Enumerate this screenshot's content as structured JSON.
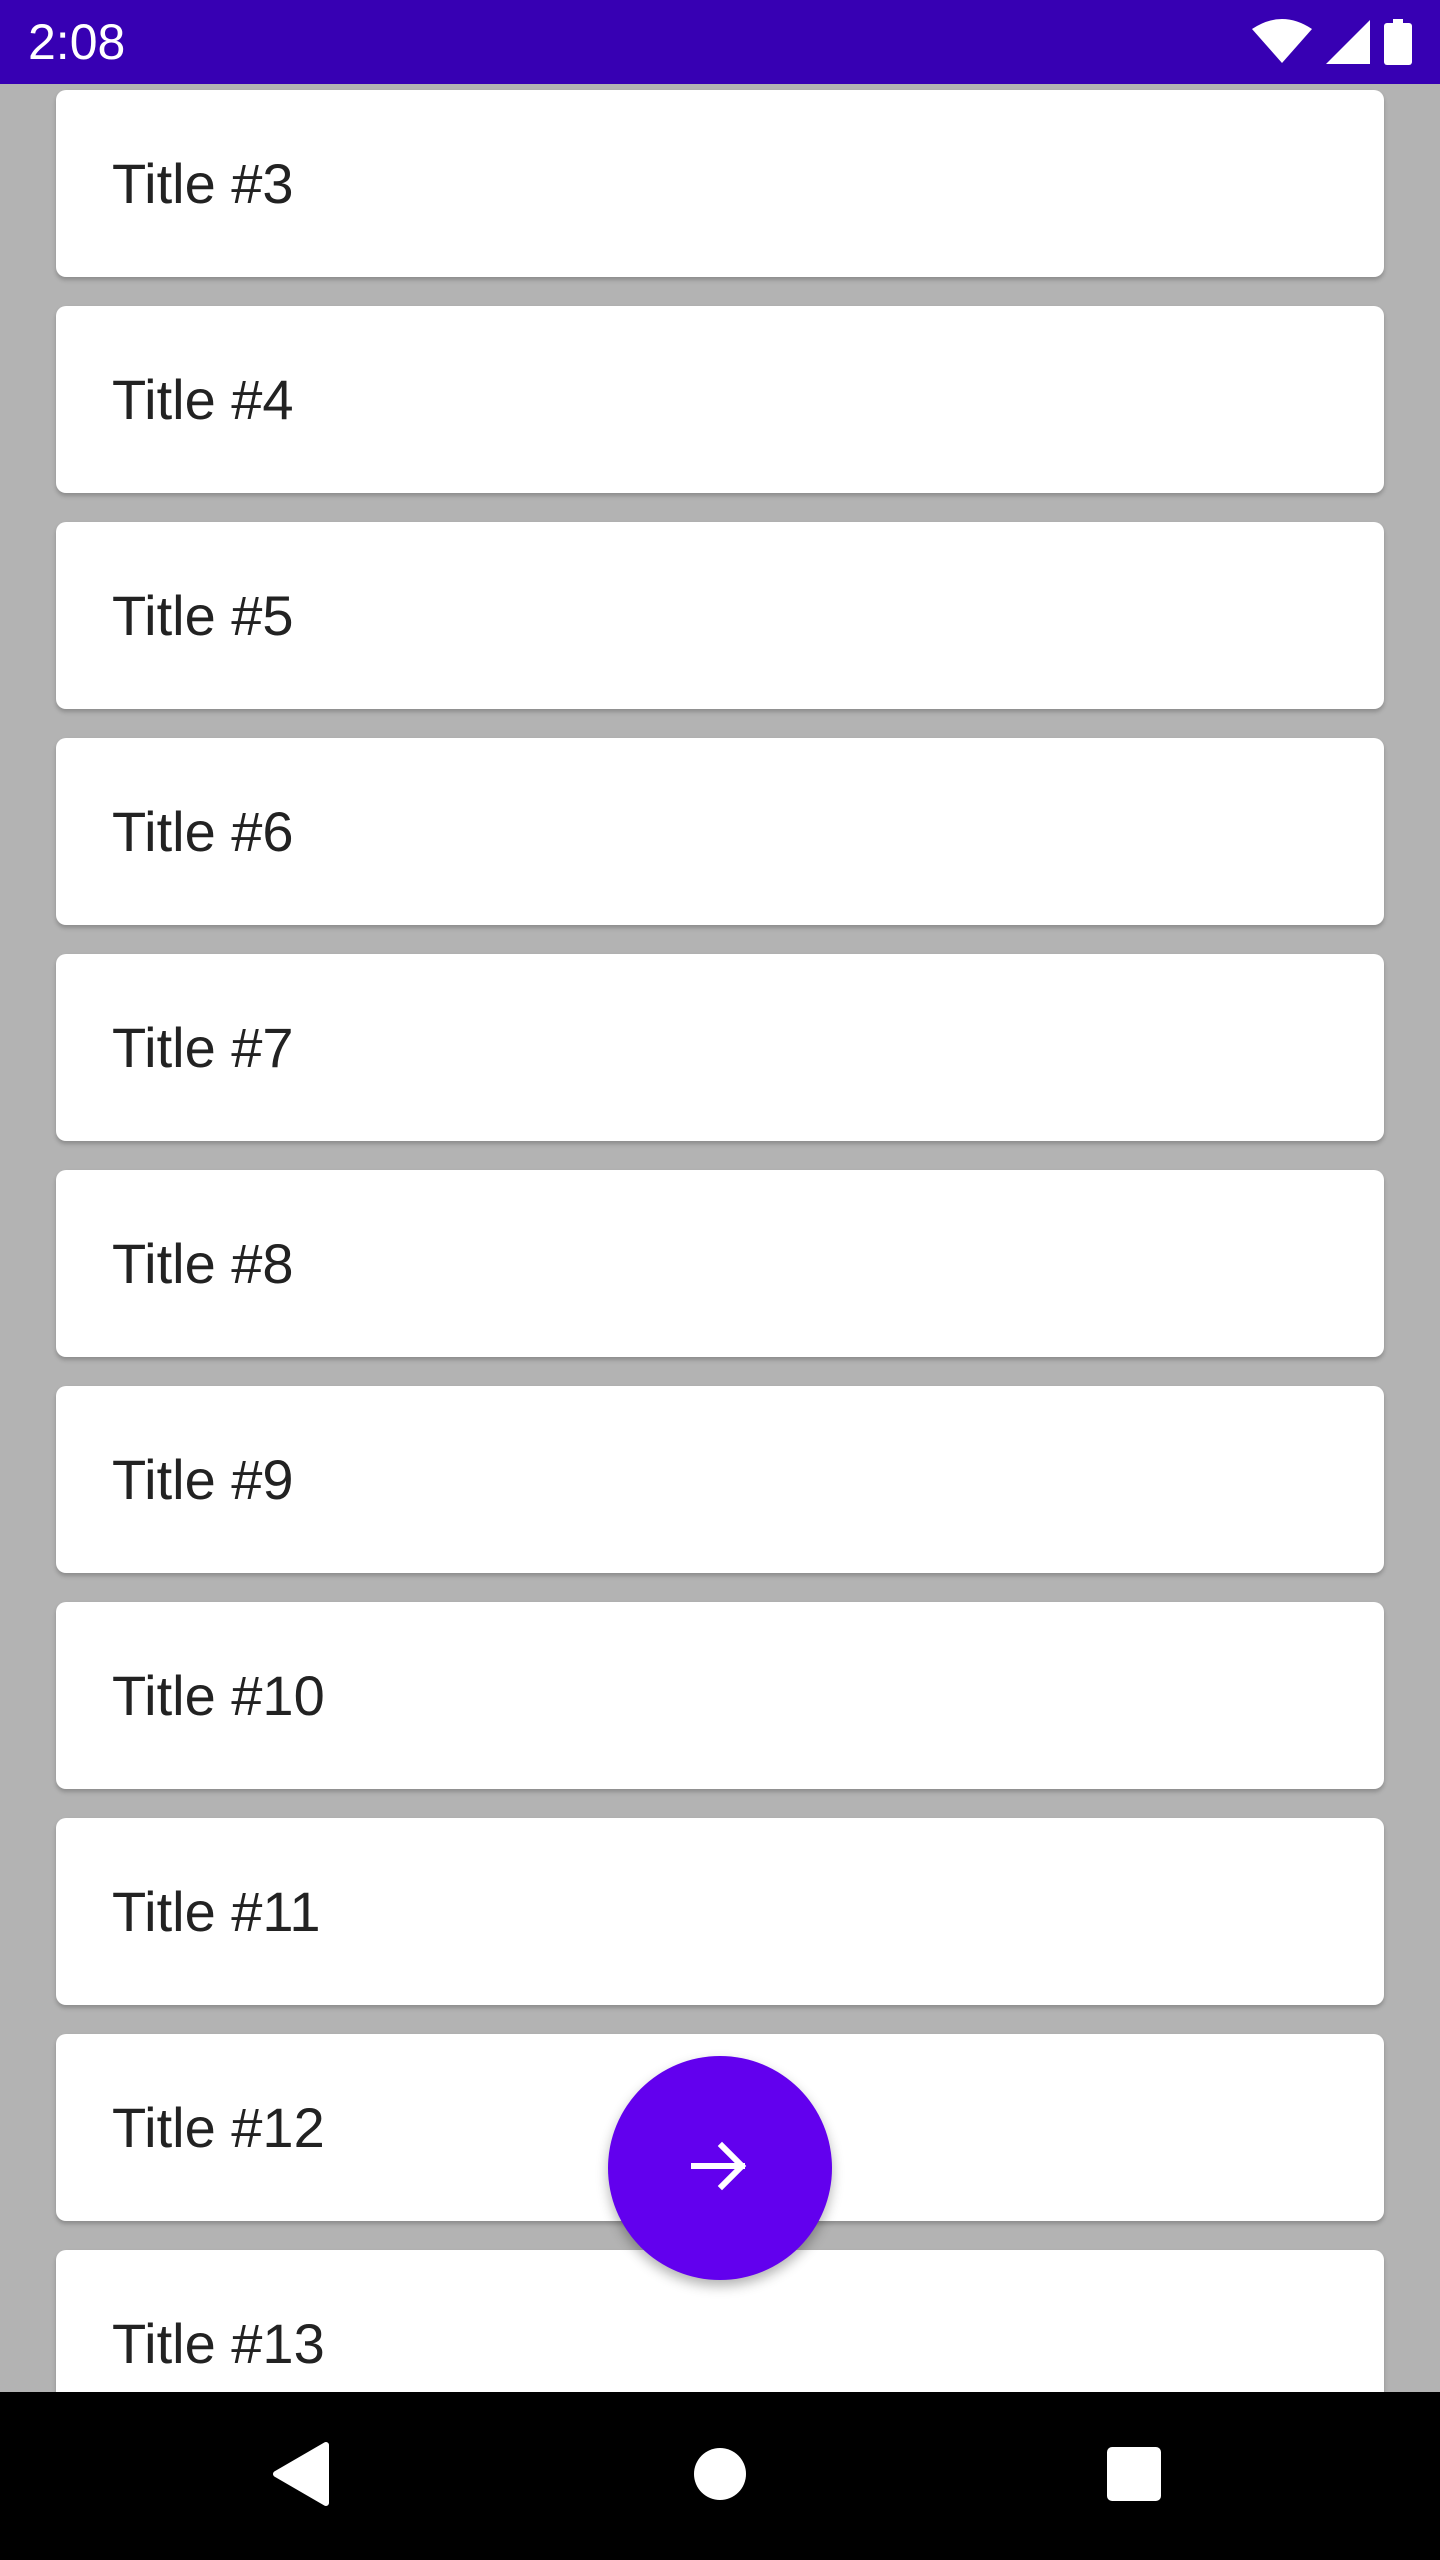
{
  "status_bar": {
    "time": "2:08",
    "background_color": "#3700b3",
    "icons": [
      "wifi-icon",
      "cellular-signal-icon",
      "battery-icon"
    ]
  },
  "list": {
    "background_color": "#b3b3b3",
    "items": [
      {
        "title": "Title #3"
      },
      {
        "title": "Title #4"
      },
      {
        "title": "Title #5"
      },
      {
        "title": "Title #6"
      },
      {
        "title": "Title #7"
      },
      {
        "title": "Title #8"
      },
      {
        "title": "Title #9"
      },
      {
        "title": "Title #10"
      },
      {
        "title": "Title #11"
      },
      {
        "title": "Title #12"
      },
      {
        "title": "Title #13"
      }
    ]
  },
  "fab": {
    "icon": "arrow-forward-icon",
    "color": "#6200ee"
  },
  "nav_bar": {
    "buttons": [
      "back-icon",
      "home-icon",
      "recents-icon"
    ]
  }
}
